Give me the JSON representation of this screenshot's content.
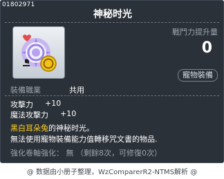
{
  "item_id": "01802971",
  "title": "神秘时光",
  "combat_power": {
    "label": "戰鬥力提升量",
    "value": "0"
  },
  "badge": "寵物裝備",
  "job_req": {
    "label": "裝備職業",
    "value": "共用"
  },
  "stats": [
    {
      "label": "攻擊力",
      "value": "+10"
    },
    {
      "label": "魔法攻擊力",
      "value": "+10"
    }
  ],
  "description": {
    "highlight": "黑白耳朵兔",
    "line1_rest": "的神秘时光。",
    "line2": "無法使用寵物裝備能力值轉移咒文書的物品."
  },
  "enhance": {
    "label": "強化卷軸強化：",
    "value": "無",
    "detail": "（剩餘8次，可修復0次）"
  },
  "footer": "@ 数据由小册子整理，WzComparerR2-NTMS解析 @",
  "colors": {
    "background": "#2b3139",
    "highlight": "#ffd21e",
    "dim_text": "#9aa3ab"
  }
}
